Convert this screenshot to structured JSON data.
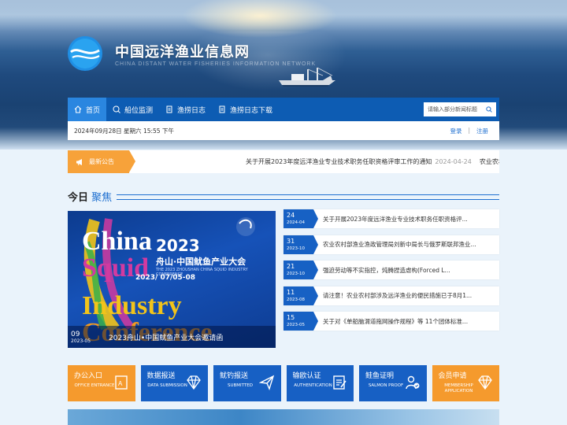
{
  "site": {
    "title": "中国远洋渔业信息网",
    "subtitle": "CHINA DISTANT WATER FISHERIES INFORMATION NETWORK"
  },
  "nav": {
    "items": [
      {
        "label": "首页",
        "icon": "home-icon"
      },
      {
        "label": "船位监测",
        "icon": "monitor-icon"
      },
      {
        "label": "渔捞日志",
        "icon": "document-icon"
      },
      {
        "label": "渔捞日志下载",
        "icon": "download-doc-icon"
      }
    ],
    "search_placeholder": "请输入部分新闻标题"
  },
  "datebar": {
    "datetime": "2024年09月28日 星期六 15:55 下午",
    "login": "登录",
    "separator": "|",
    "register": "注册"
  },
  "notice": {
    "label": "最新公告",
    "text": "关于开展2023年度远洋渔业专业技术职务任职资格评审工作的通知",
    "date": "2024-04-24",
    "next": "农业农村"
  },
  "focus": {
    "title_a": "今日",
    "title_b": "聚焦",
    "feature": {
      "poster_word1": "China",
      "poster_word2": "Squid",
      "poster_word3": "Industry",
      "poster_word4": "Conference",
      "poster_year": "2023",
      "poster_cn": "舟山·中国鱿鱼产业大会",
      "poster_en": "THE 2023 ZHOUSHAN CHINA SQUID INDUSTRY CONFERENCE",
      "poster_date": "2023/ 07/05-08",
      "day": "09",
      "month": "2023-05",
      "caption": "2023舟山•中国鱿鱼产业大会邀请函"
    },
    "news": [
      {
        "day": "24",
        "month": "2024-04",
        "title": "关于开展2023年度远洋渔业专业技术职务任职资格评..."
      },
      {
        "day": "31",
        "month": "2023-10",
        "title": "农业农村部渔业渔政管理局刘新中局长与俄罗斯联邦渔业..."
      },
      {
        "day": "21",
        "month": "2023-10",
        "title": "强迫劳动等不实指控，炖腾捏造虐构(Forced L..."
      },
      {
        "day": "11",
        "month": "2023-08",
        "title": "请注意！农业农村部涉及远洋渔业的便民措施已于8月1..."
      },
      {
        "day": "15",
        "month": "2023-05",
        "title": "关于对《单船脑渭道拖网操作规程》等 11个团体标准..."
      }
    ]
  },
  "quick_links": [
    {
      "cn": "办公入口",
      "en": "OFFICE ENTRANCE",
      "color": "#f59a2d",
      "icon": "office-icon"
    },
    {
      "cn": "数据报送",
      "en": "DATA SUBMISSION",
      "color": "#1760c4",
      "icon": "diamond-icon"
    },
    {
      "cn": "鱿钓报送",
      "en": "SUBMITTED",
      "color": "#1760c4",
      "icon": "paper-plane-icon"
    },
    {
      "cn": "输欧认证",
      "en": "AUTHENTICATION",
      "color": "#1760c4",
      "icon": "certificate-icon"
    },
    {
      "cn": "鲑鱼证明",
      "en": "SALMON PROOF",
      "color": "#1760c4",
      "icon": "user-check-icon"
    },
    {
      "cn": "会员申请",
      "en": "MEMBERSHIP APPLICATION",
      "color": "#f59a2d",
      "icon": "gem-icon"
    }
  ]
}
